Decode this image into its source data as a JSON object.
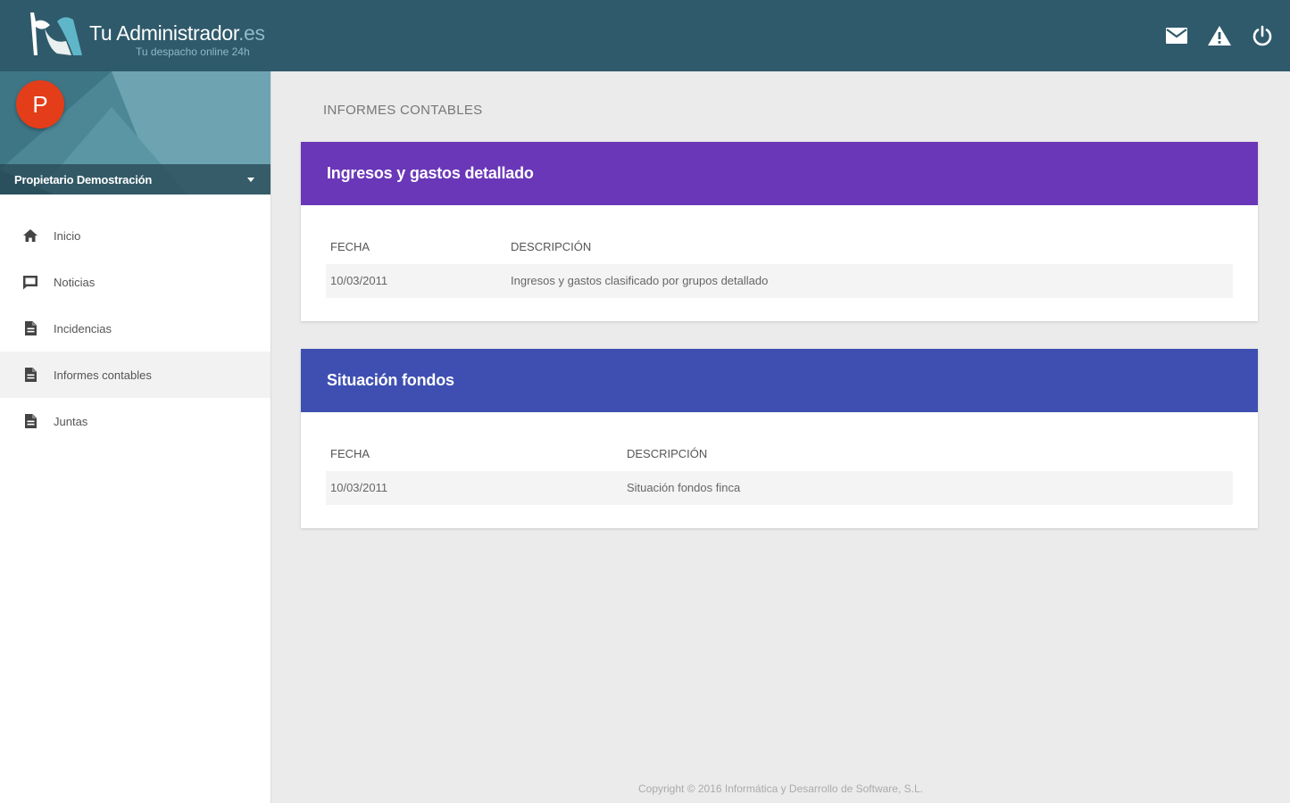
{
  "header": {
    "brand_name": "Tu Administrador",
    "brand_tld": ".es",
    "brand_tagline": "Tu despacho online 24h",
    "icons": [
      "mail-icon",
      "warning-icon",
      "power-icon"
    ]
  },
  "sidebar": {
    "avatar_letter": "P",
    "user_name": "Propietario Demostración",
    "items": [
      {
        "label": "Inicio",
        "icon": "home-icon"
      },
      {
        "label": "Noticias",
        "icon": "message-icon"
      },
      {
        "label": "Incidencias",
        "icon": "document-icon"
      },
      {
        "label": "Informes contables",
        "icon": "document-icon",
        "active": true
      },
      {
        "label": "Juntas",
        "icon": "document-icon"
      }
    ]
  },
  "main": {
    "page_title": "INFORMES CONTABLES",
    "cards": [
      {
        "title": "Ingresos y gastos detallado",
        "color": "#6a37b8",
        "columns": [
          "FECHA",
          "DESCRIPCIÓN"
        ],
        "rows": [
          {
            "fecha": "10/03/2011",
            "descripcion": "Ingresos y gastos clasificado por grupos detallado"
          }
        ]
      },
      {
        "title": "Situación fondos",
        "color": "#3e4fb1",
        "columns": [
          "FECHA",
          "DESCRIPCIÓN"
        ],
        "rows": [
          {
            "fecha": "10/03/2011",
            "descripcion": "Situación fondos finca"
          }
        ]
      }
    ]
  },
  "footer": {
    "copyright": "Copyright © 2016 Informática y Desarrollo de Software, S.L."
  }
}
